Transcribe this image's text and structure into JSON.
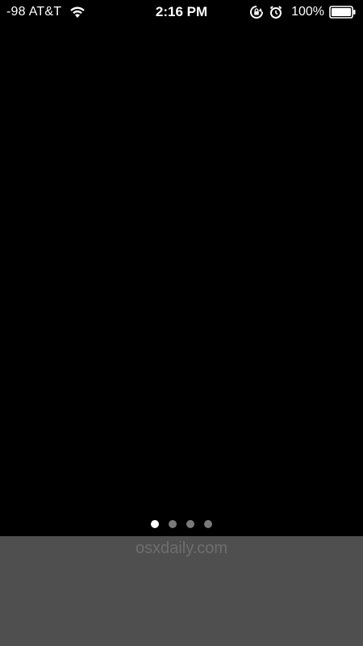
{
  "status_bar": {
    "signal_strength": "-98",
    "carrier": "AT&T",
    "time": "2:16 PM",
    "battery_percent": "100%",
    "icons": [
      "wifi-icon",
      "rotation-lock-icon",
      "alarm-icon",
      "battery-icon"
    ]
  },
  "page_indicator": {
    "total_pages": 4,
    "current_page": 1
  },
  "watermark": {
    "text": "osxdaily.com"
  },
  "colors": {
    "background": "#000000",
    "dock": "#4f4f4f",
    "dot_active": "#ffffff",
    "dot_inactive": "#7a7a7a",
    "watermark": "#6e6e6e"
  }
}
